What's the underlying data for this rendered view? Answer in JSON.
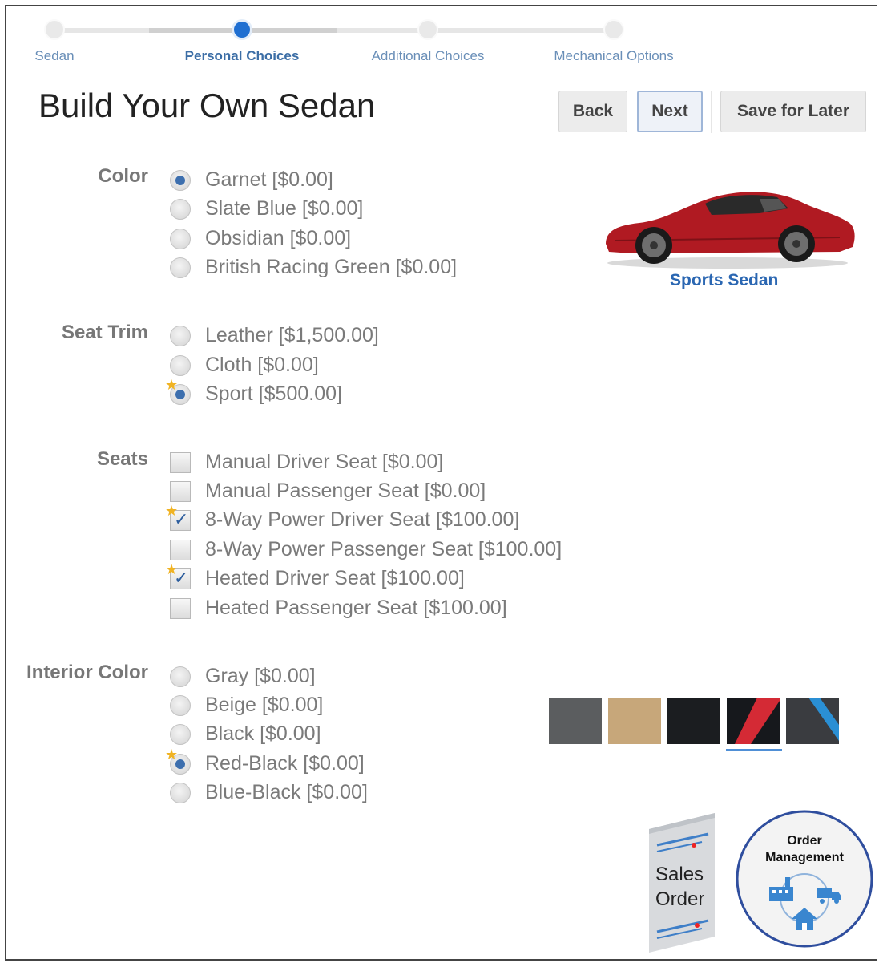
{
  "train": {
    "stops": [
      {
        "label": "Sedan"
      },
      {
        "label": "Personal Choices",
        "current": true
      },
      {
        "label": "Additional Choices"
      },
      {
        "label": "Mechanical Options"
      }
    ]
  },
  "page": {
    "title": "Build Your Own Sedan"
  },
  "buttons": {
    "back": "Back",
    "next": "Next",
    "save": "Save for Later"
  },
  "color": {
    "label": "Color",
    "options": [
      "Garnet [$0.00]",
      "Slate Blue [$0.00]",
      "Obsidian [$0.00]",
      "British Racing Green [$0.00]"
    ],
    "selected": 0
  },
  "seat_trim": {
    "label": "Seat Trim",
    "options": [
      "Leather [$1,500.00]",
      "Cloth [$0.00]",
      "Sport [$500.00]"
    ],
    "selected": 2
  },
  "seats": {
    "label": "Seats",
    "options": [
      {
        "text": "Manual Driver Seat [$0.00]",
        "checked": false
      },
      {
        "text": "Manual Passenger Seat [$0.00]",
        "checked": false
      },
      {
        "text": "8-Way Power Driver Seat [$100.00]",
        "checked": true
      },
      {
        "text": "8-Way Power Passenger Seat [$100.00]",
        "checked": false
      },
      {
        "text": "Heated Driver Seat [$100.00]",
        "checked": true
      },
      {
        "text": "Heated Passenger Seat [$100.00]",
        "checked": false
      }
    ]
  },
  "interior": {
    "label": "Interior Color",
    "options": [
      "Gray [$0.00]",
      "Beige [$0.00]",
      "Black [$0.00]",
      "Red-Black [$0.00]",
      "Blue-Black [$0.00]"
    ],
    "selected": 3
  },
  "car": {
    "label": "Sports Sedan",
    "color": "#b01a22"
  },
  "swatches": [
    {
      "name": "gray",
      "color": "#5b5d5f"
    },
    {
      "name": "beige",
      "color": "#c7a77a"
    },
    {
      "name": "black",
      "color": "#1b1d20"
    },
    {
      "name": "red-black",
      "color": "#d42a35",
      "selected": true
    },
    {
      "name": "blue-black",
      "color": "#2a8fd4"
    }
  ],
  "sales_order": {
    "line1": "Sales",
    "line2": "Order"
  },
  "order_management": {
    "line1": "Order",
    "line2": "Management"
  }
}
